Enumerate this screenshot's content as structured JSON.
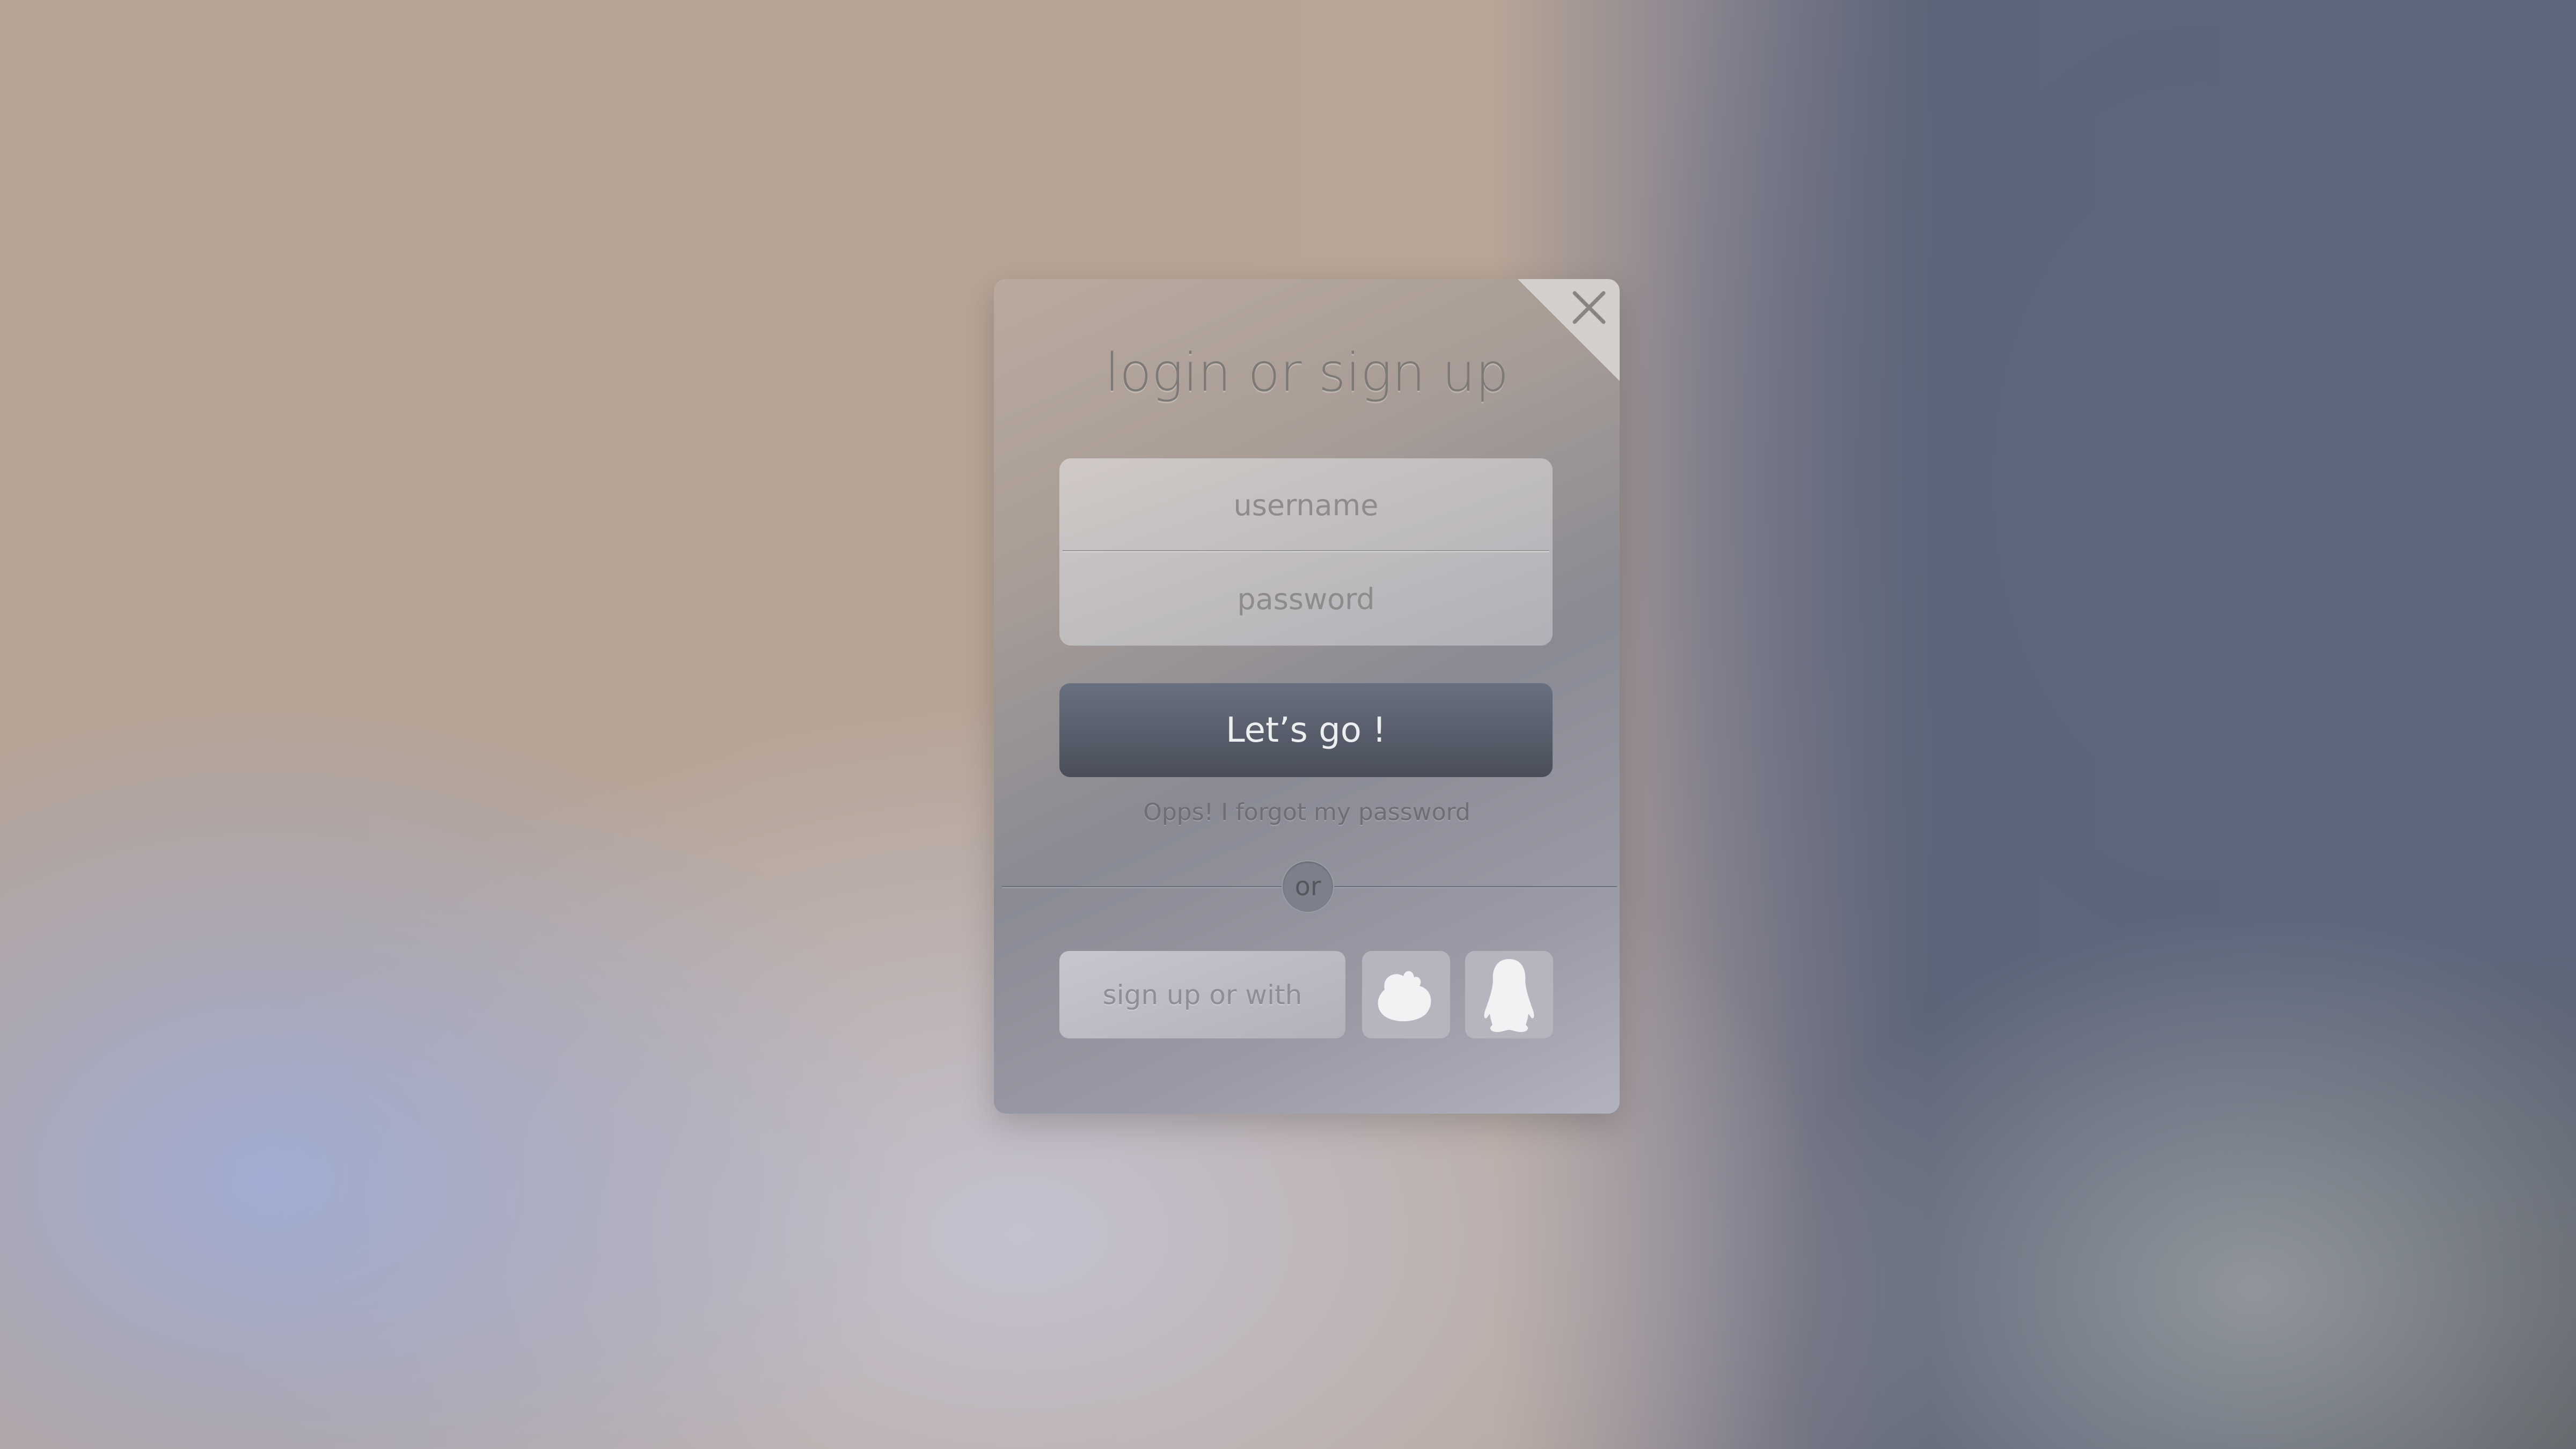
{
  "dialog": {
    "title": "login or sign up",
    "close_icon": "close-icon",
    "username_placeholder": "username",
    "password_placeholder": "password",
    "submit_label": "Let’s go !",
    "forgot_link": "Opps! I forgot my password",
    "separator": "or",
    "signup_label": "sign up or with",
    "social": [
      {
        "icon": "weibo-icon"
      },
      {
        "icon": "qq-penguin-icon"
      }
    ]
  }
}
